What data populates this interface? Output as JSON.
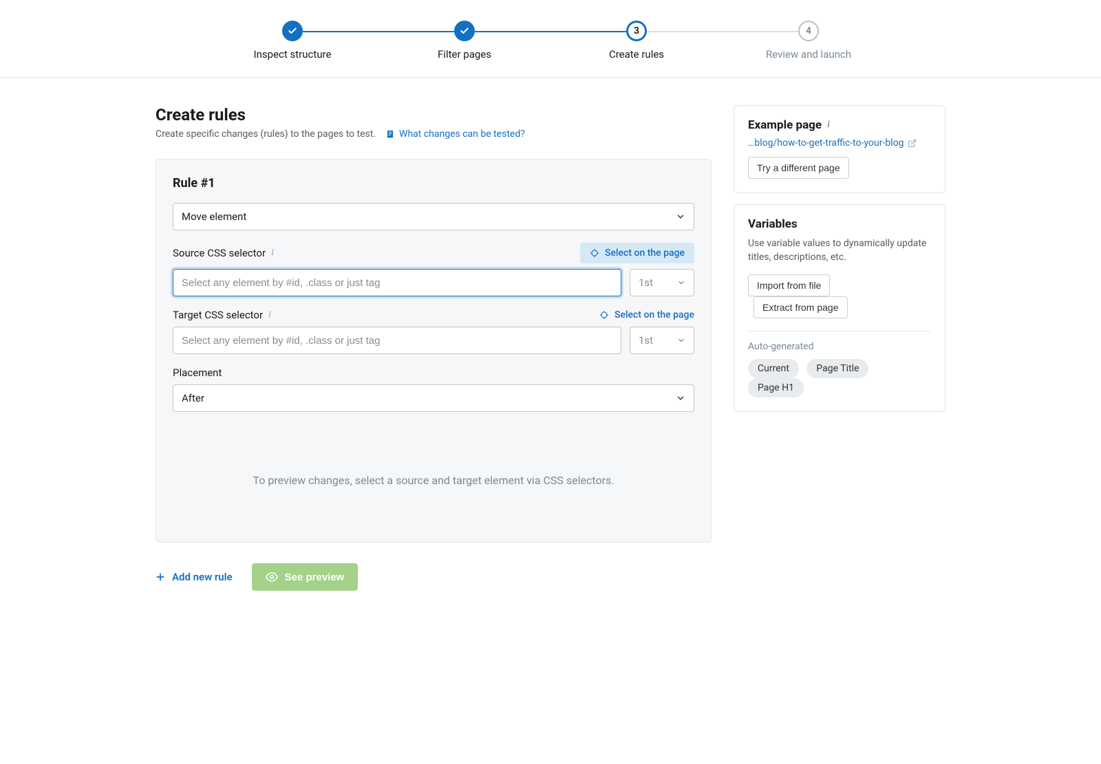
{
  "stepper": {
    "steps": [
      {
        "label": "Inspect structure",
        "state": "done"
      },
      {
        "label": "Filter pages",
        "state": "done"
      },
      {
        "label": "Create rules",
        "state": "current",
        "num": "3"
      },
      {
        "label": "Review and launch",
        "state": "pending",
        "num": "4"
      }
    ]
  },
  "page": {
    "heading": "Create rules",
    "subtitle": "Create specific changes (rules) to the pages to test.",
    "help_link": "What changes can be tested?"
  },
  "rule": {
    "title": "Rule #1",
    "type_value": "Move element",
    "source": {
      "label": "Source CSS selector",
      "select_on_page": "Select on the page",
      "placeholder": "Select any element by #id, .class or just tag",
      "order": "1st"
    },
    "target": {
      "label": "Target CSS selector",
      "select_on_page": "Select on the page",
      "placeholder": "Select any element by #id, .class or just tag",
      "order": "1st"
    },
    "placement": {
      "label": "Placement",
      "value": "After"
    },
    "preview_msg": "To preview changes, select a source and target element via CSS selectors."
  },
  "actions": {
    "add_rule": "Add new rule",
    "see_preview": "See preview"
  },
  "example": {
    "title": "Example page",
    "link": "…blog/how-to-get-traffic-to-your-blog",
    "try_different": "Try a different page"
  },
  "variables": {
    "title": "Variables",
    "desc": "Use variable values to dynamically update titles, descriptions, etc.",
    "import_btn": "Import from file",
    "extract_btn": "Extract from page",
    "auto_label": "Auto-generated",
    "chips": [
      "Current",
      "Page Title",
      "Page H1"
    ]
  }
}
